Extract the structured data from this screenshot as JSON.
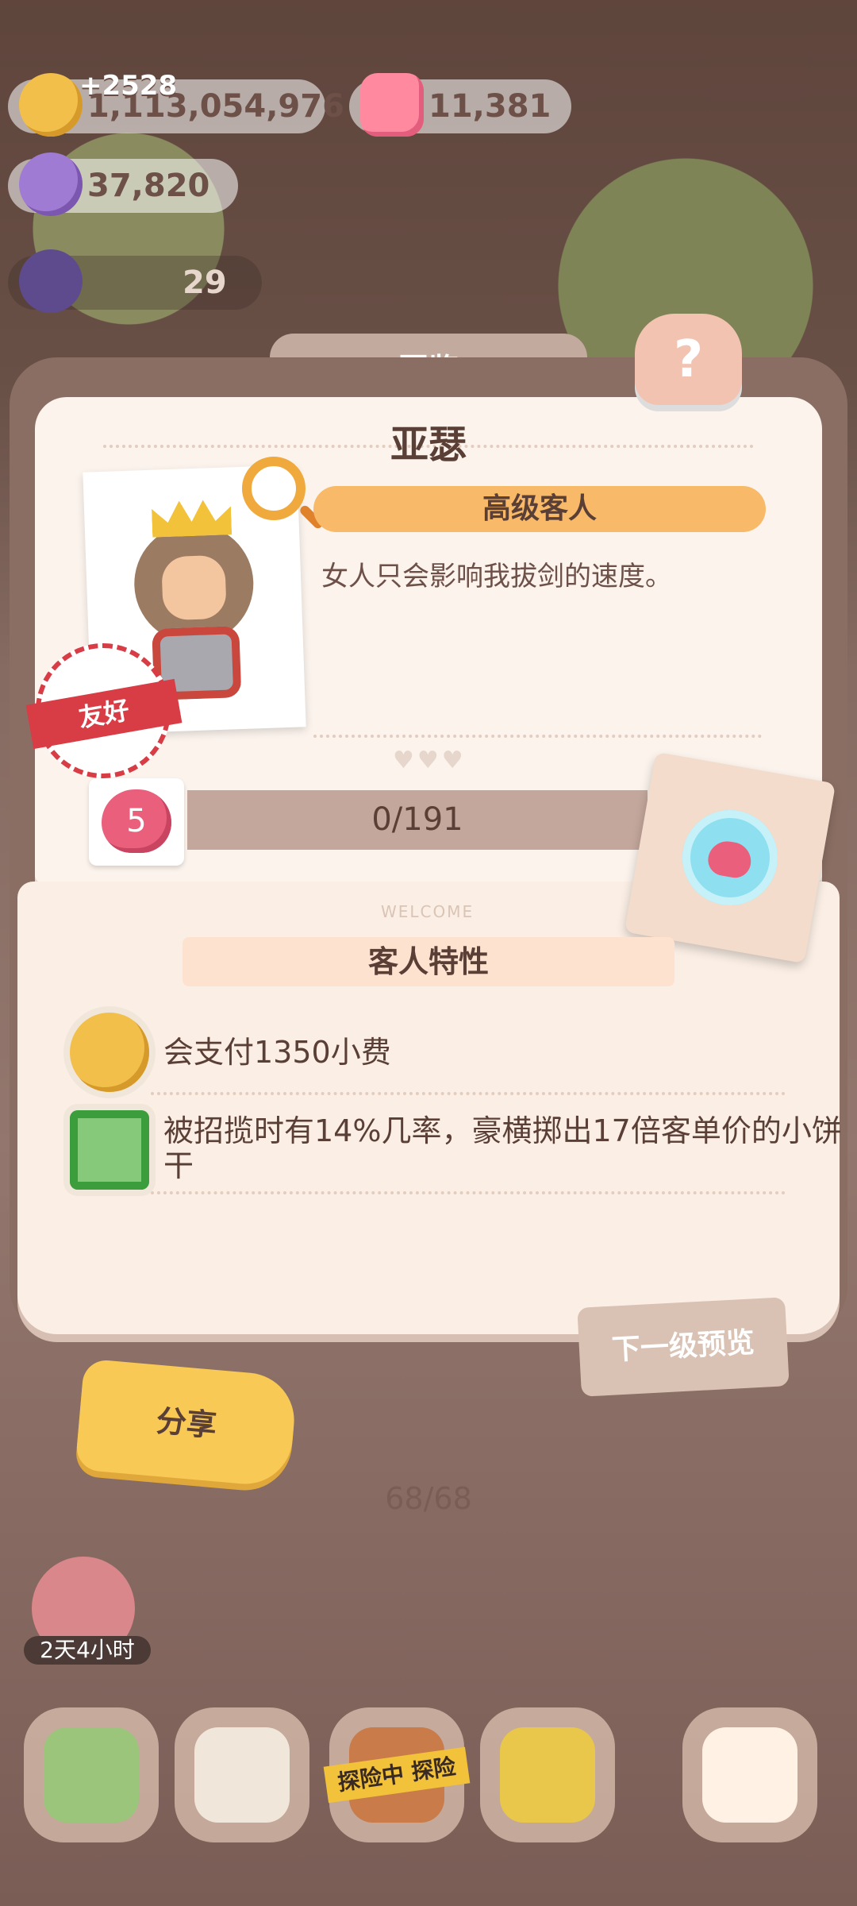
{
  "top_bar": {
    "cookies": "1,113,054,976",
    "cookies_plus": "+2528",
    "jellies": "11,381",
    "candies": "37,820",
    "cloud_count": "29"
  },
  "book": {
    "tab_title": "图鉴",
    "name": "亚瑟",
    "rank_label": "高级客人",
    "quote": "女人只会影响我拔剑的速度。",
    "stamp_label": "友好",
    "level": "5",
    "progress_text": "0/191",
    "progress": 0,
    "welcome": "WELCOME",
    "traits_title": "客人特性",
    "traits": [
      {
        "icon": "cookie-badge-icon",
        "text": "会支付1350小费"
      },
      {
        "icon": "bill-badge-icon",
        "text": "被招揽时有14%几率，豪横掷出17倍客单价的小饼干"
      }
    ],
    "share_label": "分享",
    "next_preview_label": "下一级预览",
    "pager": "68/68"
  },
  "bottom": {
    "timer": "2天4小时",
    "explore_tape": "探险中 探险"
  },
  "colors": {
    "accent": "#f8b968",
    "text": "#5a3f36"
  }
}
